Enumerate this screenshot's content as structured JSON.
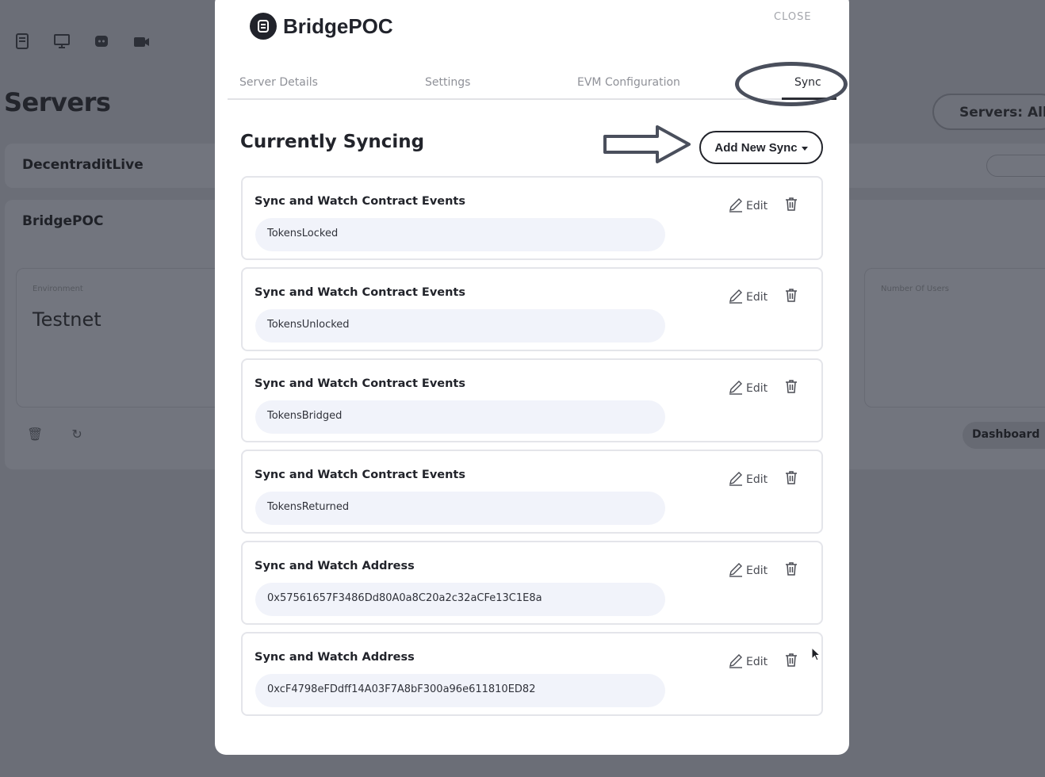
{
  "background": {
    "top_icons": [
      "book-icon",
      "monitor-icon",
      "discord-icon",
      "video-icon"
    ],
    "page_title": "Servers",
    "filter_label": "Servers: All",
    "servers": [
      {
        "name": "DecentraditLive"
      },
      {
        "name": "BridgePOC"
      }
    ],
    "environment_label": "Environment",
    "environment_value": "Testnet",
    "users_label": "Number Of Users",
    "dashboard_label": "Dashboard"
  },
  "modal": {
    "brand_name": "BridgePOC",
    "close_label": "CLOSE",
    "tabs": [
      {
        "label": "Server Details"
      },
      {
        "label": "Settings"
      },
      {
        "label": "EVM Configuration"
      },
      {
        "label": "Sync",
        "active": true
      }
    ],
    "section_title": "Currently Syncing",
    "add_button_label": "Add New Sync",
    "edit_label": "Edit",
    "syncs": [
      {
        "title": "Sync and Watch Contract Events",
        "value": "TokensLocked"
      },
      {
        "title": "Sync and Watch Contract Events",
        "value": "TokensUnlocked"
      },
      {
        "title": "Sync and Watch Contract Events",
        "value": "TokensBridged"
      },
      {
        "title": "Sync and Watch Contract Events",
        "value": "TokensReturned"
      },
      {
        "title": "Sync and Watch Address",
        "value": "0x57561657F3486Dd80A0a8C20a2c32aCFe13C1E8a"
      },
      {
        "title": "Sync and Watch Address",
        "value": "0xcF4798eFDdff14A03F7A8bF300a96e611810ED82"
      }
    ]
  },
  "colors": {
    "overlay": "#6b6e77",
    "modal_bg": "#ffffff",
    "text_dark": "#22242b",
    "tab_inactive": "#8f9198",
    "pill_bg": "#f1f3fa",
    "annotation": "#4a4f5c"
  }
}
